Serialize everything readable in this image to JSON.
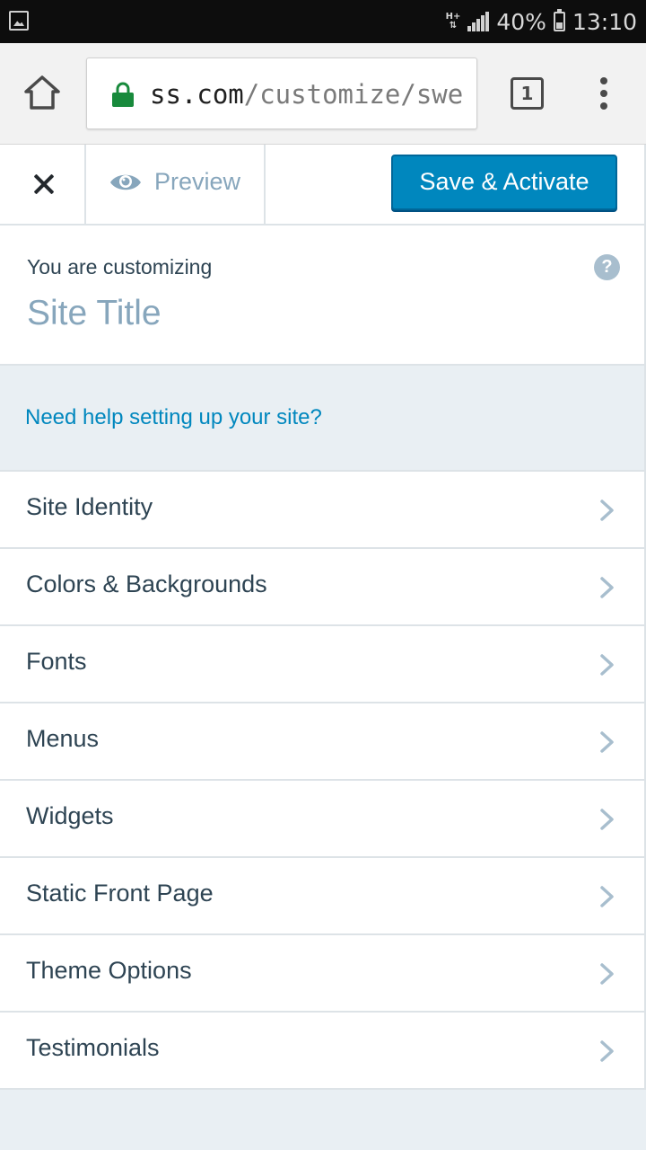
{
  "status_bar": {
    "network": "H+",
    "battery": "40%",
    "battery_level": 0.4,
    "time": "13:10"
  },
  "browser": {
    "url_prefix": "ss",
    "url_domain_end": ".com",
    "url_path": "/customize/swe",
    "tab_count": "1",
    "icons": [
      "home-icon",
      "lock-icon",
      "tabs-icon",
      "overflow-menu-icon"
    ]
  },
  "header": {
    "preview_label": "Preview",
    "save_label": "Save & Activate"
  },
  "customizing": {
    "pre_text": "You are customizing",
    "site_title": "Site Title",
    "help_icon": "?"
  },
  "help_link": "Need help setting up your site?",
  "menu": [
    {
      "label": "Site Identity"
    },
    {
      "label": "Colors & Backgrounds"
    },
    {
      "label": "Fonts"
    },
    {
      "label": "Menus"
    },
    {
      "label": "Widgets"
    },
    {
      "label": "Static Front Page"
    },
    {
      "label": "Theme Options"
    },
    {
      "label": "Testimonials"
    }
  ],
  "colors": {
    "accent": "#0087be",
    "muted": "#87a6bc",
    "text": "#2e4453",
    "lock": "#188a3c"
  }
}
